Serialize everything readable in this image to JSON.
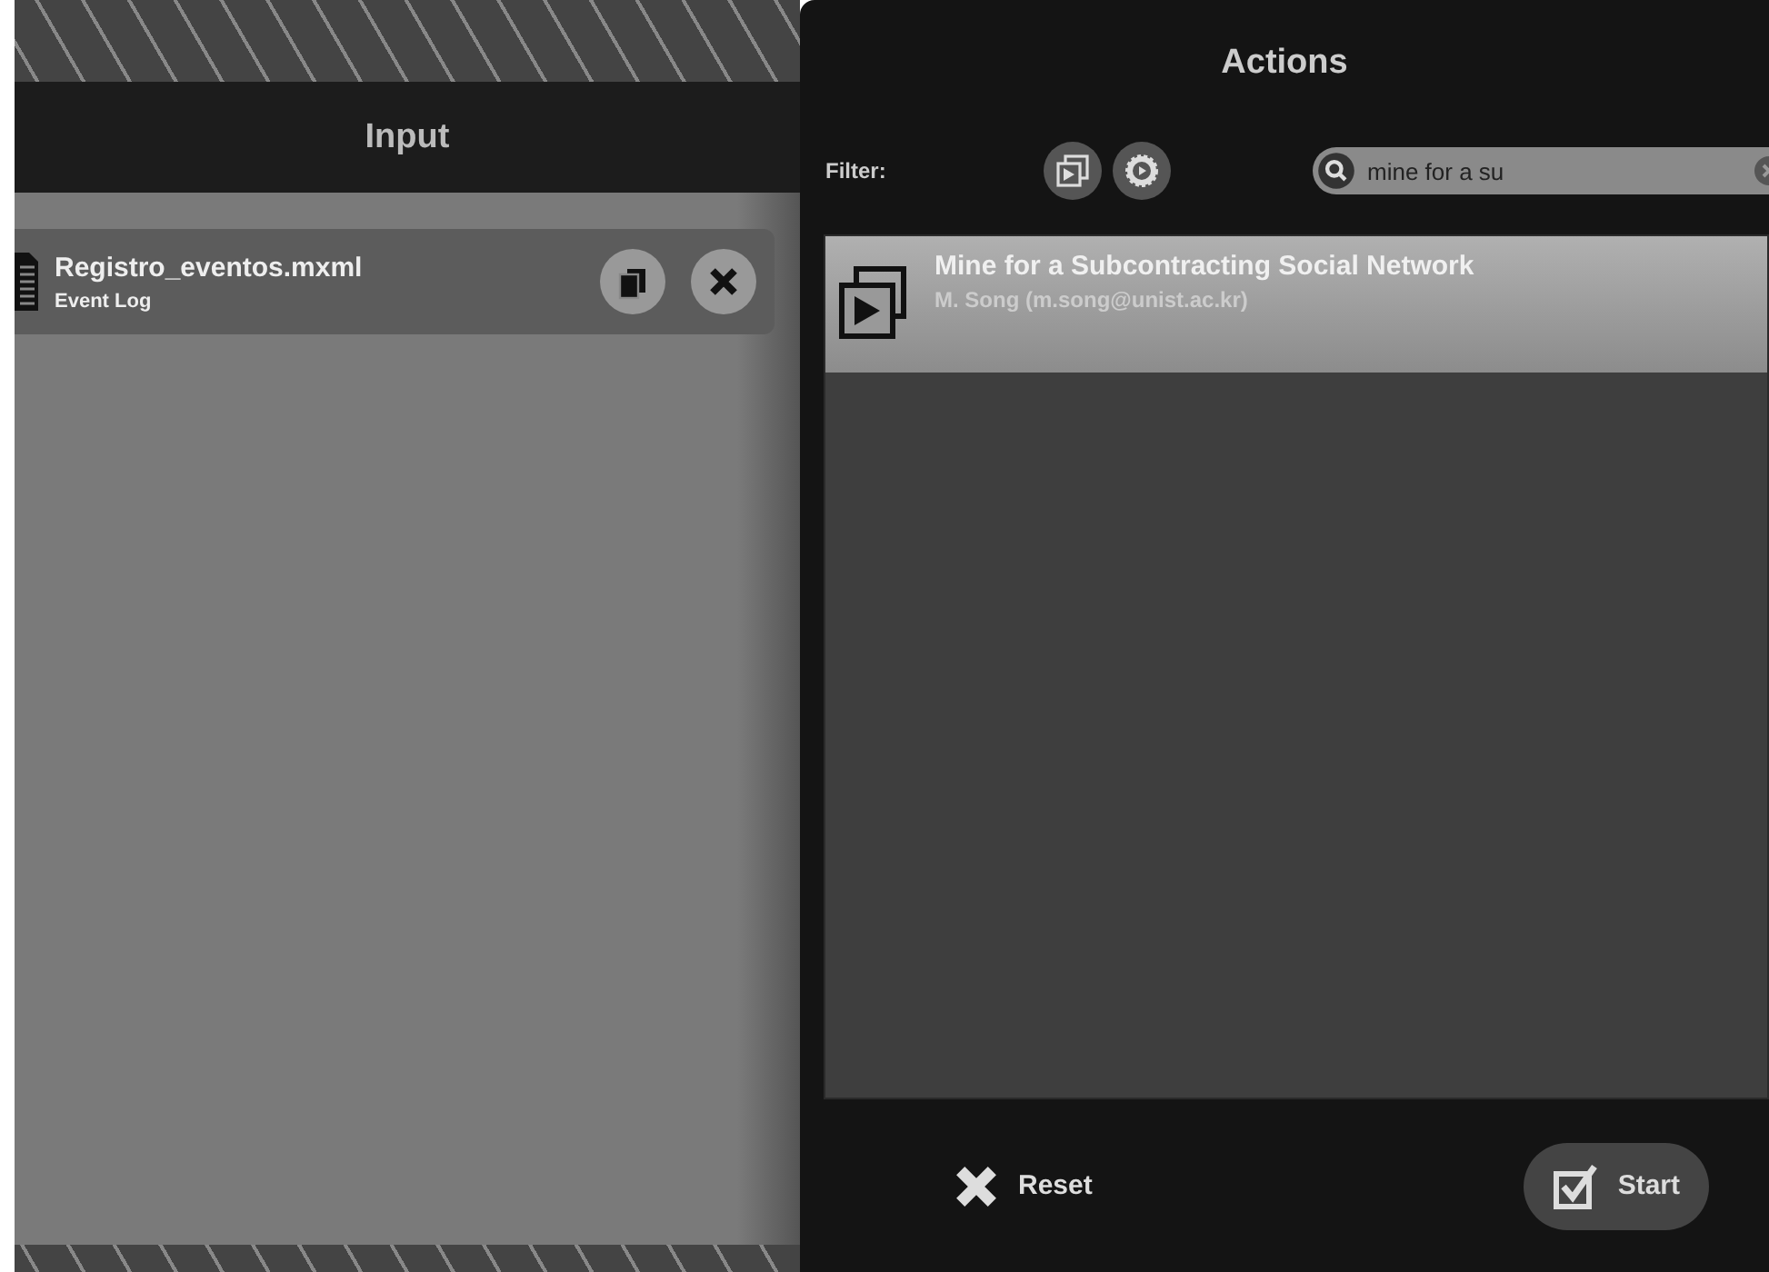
{
  "input_panel": {
    "title": "Input",
    "items": [
      {
        "name": "Registro_eventos.mxml",
        "type": "Event Log"
      }
    ]
  },
  "actions_panel": {
    "title": "Actions",
    "filter_label": "Filter:",
    "search": {
      "value": "mine for a su"
    },
    "actions": [
      {
        "title": "Mine for a Subcontracting Social Network",
        "author": "M. Song (m.song@unist.ac.kr)",
        "selected": true
      }
    ],
    "buttons": [
      {
        "kind": "reset",
        "label": "Reset"
      },
      {
        "kind": "start",
        "label": "Start"
      }
    ]
  }
}
